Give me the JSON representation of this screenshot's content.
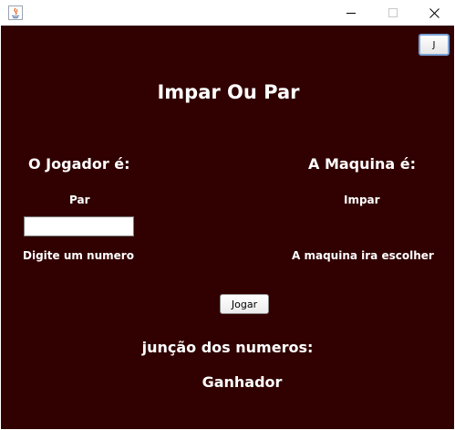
{
  "window": {
    "title": "",
    "app_icon": "java-icon",
    "controls": {
      "minimize": "minimize-icon",
      "maximize": "maximize-icon",
      "close": "close-icon"
    }
  },
  "colors": {
    "background": "#310000",
    "text": "#ffffff",
    "button_focus_border": "#7aa2d6"
  },
  "corner_button": {
    "label": "J"
  },
  "title": "Impar Ou Par",
  "player": {
    "heading": "O Jogador é:",
    "choice": "Par",
    "input_value": "",
    "hint": "Digite um numero"
  },
  "machine": {
    "heading": "A Maquina é:",
    "choice": "Impar",
    "hint": "A maquina ira escolher"
  },
  "play_button": {
    "label": "Jogar"
  },
  "sum_label": "junção dos numeros:",
  "winner_label": "Ganhador"
}
